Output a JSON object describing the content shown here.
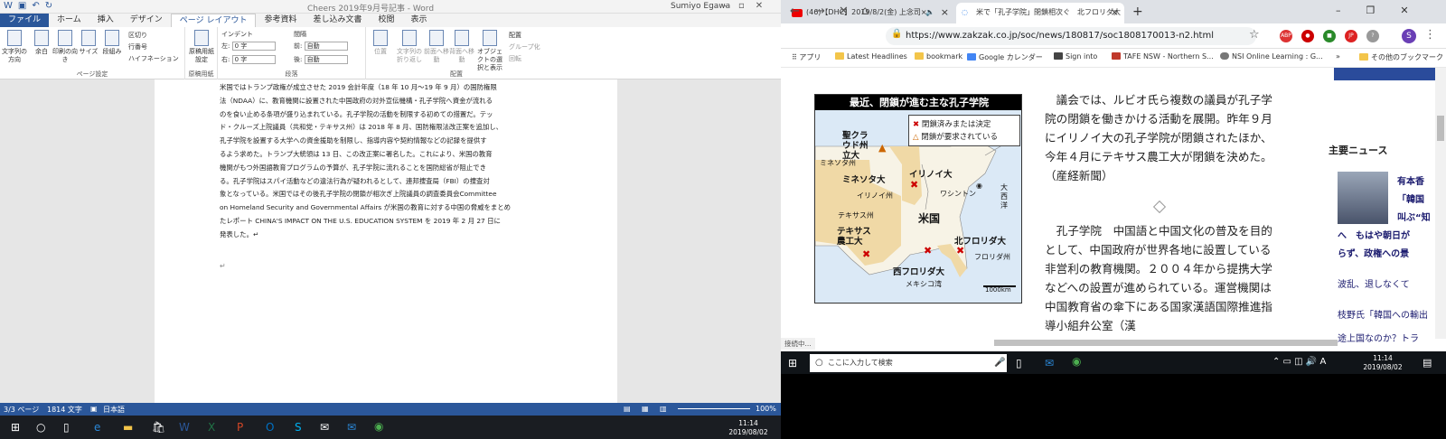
{
  "word": {
    "title": "Cheers 2019年9月号記事 - Word",
    "user": "Sumiyo Egawa",
    "tabs": [
      "ファイル",
      "ホーム",
      "挿入",
      "デザイン",
      "ページ レイアウト",
      "参考資料",
      "差し込み文書",
      "校閲",
      "表示"
    ],
    "ribbon": {
      "page_setup": {
        "label": "ページ設定",
        "buttons": [
          "文字列の方向",
          "余白",
          "印刷の向き",
          "サイズ",
          "段組み"
        ],
        "small": [
          "区切り",
          "行番号",
          "ハイフネーション"
        ]
      },
      "genko": {
        "label": "原稿用紙",
        "button": "原稿用紙設定"
      },
      "paragraph": {
        "label": "段落",
        "indent_title": "インデント",
        "spacing_title": "間隔",
        "left_label": "左:",
        "left_value": "0 字",
        "right_label": "右:",
        "right_value": "0 字",
        "before_label": "前:",
        "before_value": "自動",
        "after_label": "後:",
        "after_value": "自動"
      },
      "arrange": {
        "label": "配置",
        "buttons": [
          "位置",
          "文字列の折り返し",
          "前面へ移動",
          "背面へ移動",
          "オブジェクトの選択と表示"
        ],
        "small": [
          "配置",
          "グループ化",
          "回転"
        ]
      }
    },
    "body_lines": [
      "米国ではトランプ政権が成立させた 2019 会計年度（18 年 10 月～19 年 9 月）の国防権限",
      "法（NDAA）に、教育機関に設置された中国政府の対外宣伝機構・孔子学院へ資金が流れる",
      "のを食い止める条項が盛り込まれている。孔子学院の活動を制限する初めての措置だ。テッ",
      "ド・クルーズ上院議員（共和党・テキサス州）は 2018 年 8 月、国防権限法改正案を追加し、",
      "孔子学院を設置する大学への資金援助を制限し、指導内容や契約情報などの記録を提供す",
      "るよう求めた。トランプ大統領は 13 日、この改正案に署名した。これにより、米国の教育",
      "機関がもつ外国語教育プログラムの予算が、孔子学院に流れることを国防総省が阻止でき",
      "る。孔子学院はスパイ活動などの違法行為が疑われるとして、連邦捜査局（FBI）の捜査対",
      "象となっている。米国ではその後孔子学院の閉鎖が相次ぎ上院議員の調査委員会Committee",
      "on Homeland Security and Governmental Affairs が米国の教育に対する中国の脅威をまとめ",
      "たレポート CHINA'S IMPACT ON THE U.S. EDUCATION SYSTEM を 2019 年 2 月 27 日に",
      "発表した。↵"
    ],
    "status": {
      "page": "3/3 ページ",
      "words": "1814 文字",
      "lang": "日本語",
      "zoom": "100%"
    }
  },
  "chrome": {
    "tabs": [
      {
        "title": "(46)【DHC】2019/8/2(金) 上念司×"
      },
      {
        "title": "米で「孔子学院」閉鎖相次ぐ　北フロリダ大"
      }
    ],
    "url": "https://www.zakzak.co.jp/soc/news/180817/soc1808170013-n2.html",
    "bookmarks": [
      "アプリ",
      "Latest Headlines",
      "bookmark",
      "Google カレンダー",
      "Sign into",
      "TAFE NSW - Northern S...",
      "NSI Online Learning : G...",
      "その他のブックマーク"
    ],
    "status_text": "接続中...",
    "article": {
      "paragraphs": [
        "議会では、ルビオ氏ら複数の議員が孔子学院の閉鎖を働きかける活動を展開。昨年９月にイリノイ大の孔子学院が閉鎖されたほか、今年４月にテキサス農工大が閉鎖を決めた。（産経新聞）",
        "孔子学院　中国語と中国文化の普及を目的として、中国政府が世界各地に設置している非営利の教育機関。２００４年から提携大学などへの設置が進められている。運営機関は中国教育省の傘下にある国家漢語国際推進指導小組弁公室（漢"
      ]
    },
    "map": {
      "title": "最近、閉鎖が進む主な孔子学院",
      "legend": [
        "閉鎖済みまたは決定",
        "閉鎖が要求されている"
      ],
      "labels": {
        "sc": "聖クラウド州立大",
        "mn_state": "ミネソタ州",
        "mn_univ": "ミネソタ大",
        "il_univ": "イリノイ大",
        "il_state": "イリノイ州",
        "dc": "ワシントン",
        "atlantic": "大西洋",
        "tx_state": "テキサス州",
        "us": "米国",
        "tx_univ": "テキサス農工大",
        "nf_univ": "北フロリダ大",
        "fl_state": "フロリダ州",
        "wf_univ": "西フロリダ大",
        "gulf": "メキシコ湾",
        "scale": "1000km"
      }
    },
    "side": {
      "head": "主要ニュース",
      "items": [
        "有本香",
        "「韓国",
        "叫ぶ“知",
        "へ　もはや朝日が",
        "らず、政権への景",
        "波乱、退しなくて",
        "枝野氏「韓国への輸出",
        "途上国なのか？トラ"
      ]
    }
  },
  "taskbar": {
    "search_placeholder": "ここに入力して検索",
    "right_time": "11:14",
    "right_date": "2019/08/02",
    "left_time": "11:14",
    "left_date": "2019/08/02"
  }
}
